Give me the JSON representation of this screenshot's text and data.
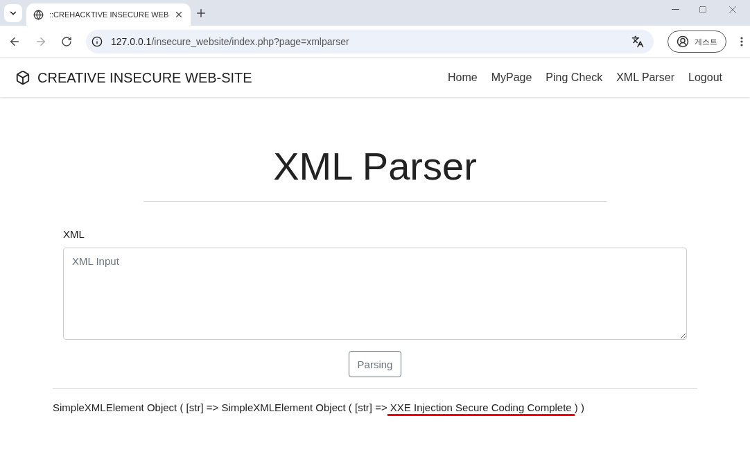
{
  "browser": {
    "tab_title": "::CREHACKTIVE INSECURE WEB",
    "url_host": "127.0.0.1",
    "url_path": "/insecure_website/index.php?page=xmlparser",
    "profile": "게스트"
  },
  "navbar": {
    "brand": "CREATIVE INSECURE WEB-SITE",
    "links": [
      {
        "label": "Home"
      },
      {
        "label": "MyPage"
      },
      {
        "label": "Ping Check"
      },
      {
        "label": "XML Parser"
      },
      {
        "label": "Logout"
      }
    ]
  },
  "page": {
    "title": "XML Parser",
    "field_label": "XML",
    "placeholder": "XML Input",
    "button": "Parsing"
  },
  "result": {
    "before": "SimpleXMLElement Object ( [str] => SimpleXMLElement Object ( [str] => ",
    "marked": "XXE Injection Secure Coding Complete",
    "after": " ) )",
    "annotation": {
      "kind": "underline",
      "color": "#ff0000"
    }
  }
}
